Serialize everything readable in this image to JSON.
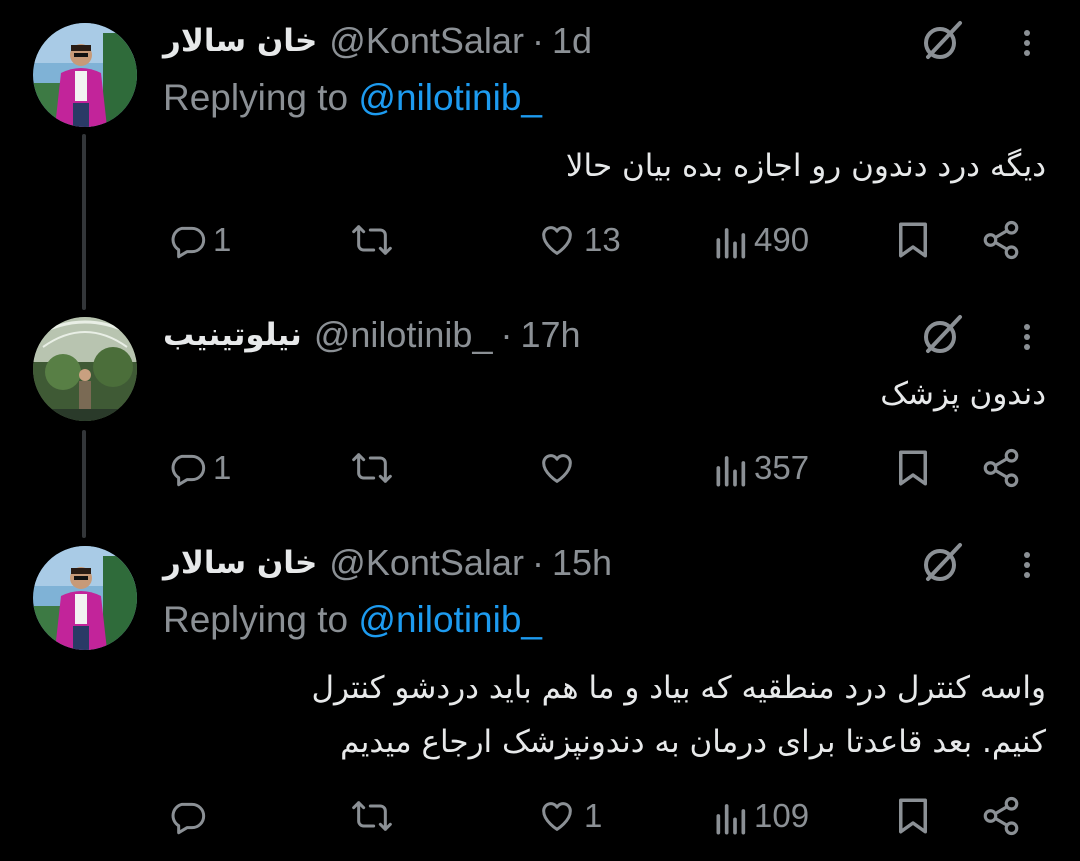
{
  "tweets": [
    {
      "name": "خان سالار",
      "handle": "@KontSalar",
      "separator": "·",
      "time": "1d",
      "replying_prefix": "Replying to",
      "replying_to": "@nilotinib_",
      "lines": [
        "دیگه درد دندون رو اجازه بده بیان حالا"
      ],
      "stats": {
        "replies": "1",
        "reposts": "",
        "likes": "13",
        "views": "490"
      }
    },
    {
      "name": "نیلوتینیب",
      "handle": "@nilotinib_",
      "separator": "·",
      "time": "17h",
      "lines": [
        "دندون پزشک"
      ],
      "stats": {
        "replies": "1",
        "reposts": "",
        "likes": "",
        "views": "357"
      }
    },
    {
      "name": "خان سالار",
      "handle": "@KontSalar",
      "separator": "·",
      "time": "15h",
      "replying_prefix": "Replying to",
      "replying_to": "@nilotinib_",
      "lines": [
        "واسه کنترل درد منطقیه که بیاد و ما هم باید دردشو کنترل",
        "کنیم. بعد قاعدتا برای درمان به دندونپزشک ارجاع میدیم"
      ],
      "stats": {
        "replies": "",
        "reposts": "",
        "likes": "1",
        "views": "109"
      }
    }
  ],
  "icons": {
    "reply": "reply-icon",
    "repost": "repost-icon",
    "like": "like-icon",
    "views": "views-icon",
    "bookmark": "bookmark-icon",
    "share": "share-icon",
    "grok": "grok-icon",
    "more": "more-icon"
  },
  "colors": {
    "background": "#000000",
    "text": "#e7e9ea",
    "muted": "#8b9095",
    "link": "#1d9bf0",
    "thread_line": "#333639"
  }
}
